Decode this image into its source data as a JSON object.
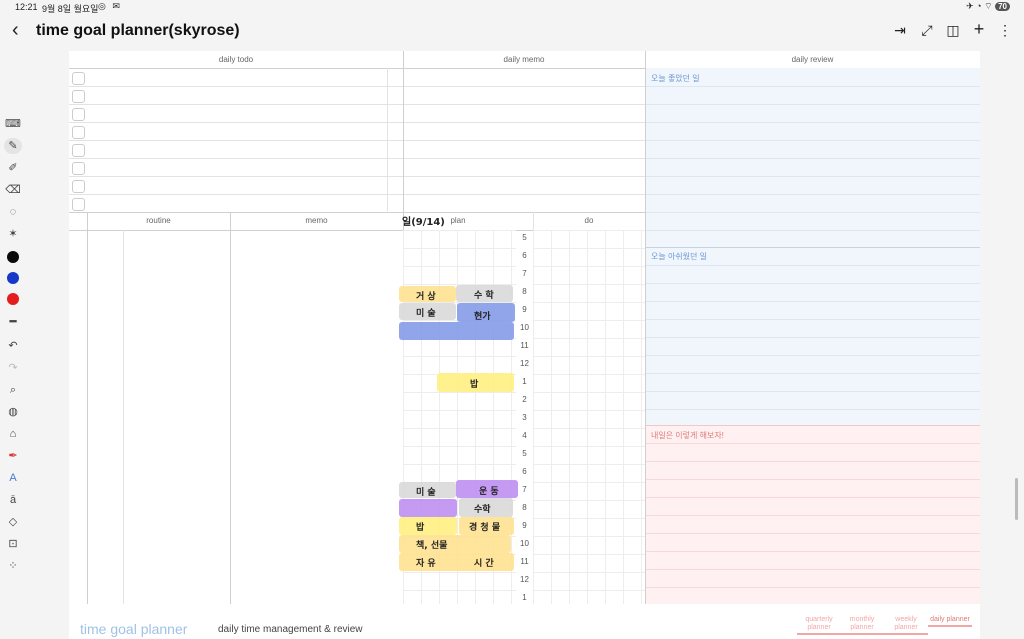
{
  "status": {
    "time": "12:21",
    "date": "9월 8일 월요일",
    "battery": "70"
  },
  "app": {
    "title": "time goal planner(skyrose)"
  },
  "tools": [
    "keyboard-icon",
    "pen-icon",
    "highlighter-icon",
    "eraser-icon",
    "lasso-icon",
    "shape-icon",
    "black",
    "blue",
    "red",
    "line-width-icon",
    "undo-icon",
    "redo-icon",
    "zoom-icon",
    "sticker-icon",
    "image-icon",
    "marker-icon",
    "text-icon",
    "textbox-icon",
    "shapes-icon",
    "lock-icon",
    "more-icon"
  ],
  "colors": {
    "black": "#0a0a0a",
    "blue": "#1538c9",
    "red": "#e41d1d",
    "review_blue": "#f1f6fd",
    "review_red": "#fff1f1"
  },
  "sections": {
    "daily_todo": "daily todo",
    "daily_memo": "daily memo",
    "daily_review": "daily review",
    "routine": "routine",
    "memo": "memo",
    "plan": "plan",
    "do": "do"
  },
  "review": {
    "good": "오늘 좋았던 일",
    "regret": "오늘 아쉬웠던 일",
    "tomorrow": "내일은 이렇게 해보자!"
  },
  "handwritten": {
    "date": "일(9/14)",
    "entries": [
      "거 상",
      "수 학",
      "미 술",
      "현가",
      "밥",
      "미 술",
      "운 동",
      "수학",
      "밥",
      "경 청 물",
      "책, 선물",
      "자 유",
      "시 간"
    ]
  },
  "hours": [
    "5",
    "6",
    "7",
    "8",
    "9",
    "10",
    "11",
    "12",
    "1",
    "2",
    "3",
    "4",
    "5",
    "6",
    "7",
    "8",
    "9",
    "10",
    "11",
    "12",
    "1"
  ],
  "footer": {
    "brand": "time goal planner",
    "subtitle": "daily time management & review",
    "tabs": [
      "quarterly planner",
      "monthly planner",
      "weekly planner",
      "daily planner"
    ]
  }
}
